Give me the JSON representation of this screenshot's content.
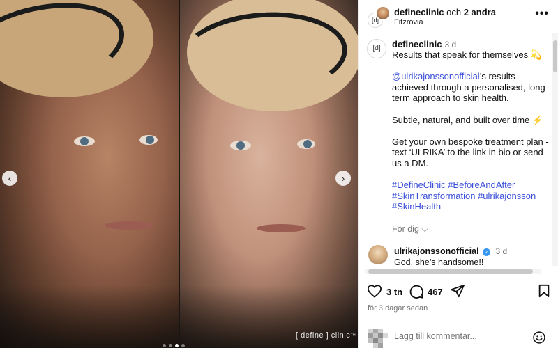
{
  "media": {
    "watermark": "[ define ] clinic",
    "watermark_suffix": "™",
    "prev_icon": "‹",
    "next_icon": "›",
    "carousel_dots": 4,
    "carousel_active_index": 2
  },
  "header": {
    "username": "defineclinic",
    "collab_connector": " och ",
    "collab_others": "2 andra",
    "location": "Fitzrovia",
    "more_icon": "•••",
    "brand_avatar_text": "[d]"
  },
  "caption": {
    "username": "defineclinic",
    "age": "3 d",
    "line1": "Results that speak for themselves",
    "line1_emoji": "💫",
    "mention": "@ulrikajonssonofficial",
    "para2": "’s results - achieved through a personalised, long-term approach to skin health.",
    "para3": "Subtle, natural, and built over time",
    "para3_emoji": "⚡",
    "para4": "Get your own bespoke treatment plan - text ‘ULRIKA’ to the link in bio or send us a DM.",
    "hashtags": "#DefineClinic #BeforeAndAfter #SkinTransformation #ulrikajonsson #SkinHealth",
    "show_more": "För dig ⌵"
  },
  "comment": {
    "username": "ulrikajonssonofficial",
    "verified_mark": "✓",
    "age": "3 d",
    "text": "God, she’s handsome!!"
  },
  "actions": {
    "likes": "3 tn",
    "comments": "467",
    "timestamp": "för 3 dagar sedan"
  },
  "add_comment": {
    "placeholder": "Lägg till kommentar..."
  },
  "colors": {
    "link": "#3a4fd9",
    "verified": "#3897f0",
    "muted": "#737373"
  }
}
